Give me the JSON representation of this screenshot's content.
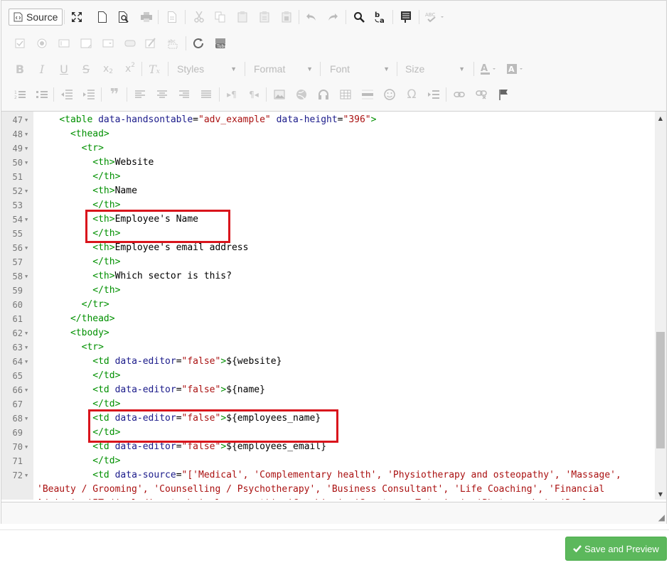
{
  "toolbar": {
    "source_label": "Source",
    "styles_label": "Styles",
    "format_label": "Format",
    "font_label": "Font",
    "size_label": "Size"
  },
  "code": {
    "lines": [
      {
        "n": "47",
        "fold": true,
        "html": "    <span class=\"tag\">&lt;table</span> <span class=\"attr\">data-handsontable</span>=<span class=\"str\">\"adv_example\"</span> <span class=\"attr\">data-height</span>=<span class=\"str\">\"396\"</span><span class=\"tag\">&gt;</span>"
      },
      {
        "n": "48",
        "fold": true,
        "html": "      <span class=\"tag\">&lt;thead&gt;</span>"
      },
      {
        "n": "49",
        "fold": true,
        "html": "        <span class=\"tag\">&lt;tr&gt;</span>"
      },
      {
        "n": "50",
        "fold": true,
        "html": "          <span class=\"tag\">&lt;th&gt;</span>Website"
      },
      {
        "n": "51",
        "fold": false,
        "html": "          <span class=\"tag\">&lt;/th&gt;</span>"
      },
      {
        "n": "52",
        "fold": true,
        "html": "          <span class=\"tag\">&lt;th&gt;</span>Name"
      },
      {
        "n": "53",
        "fold": false,
        "html": "          <span class=\"tag\">&lt;/th&gt;</span>"
      },
      {
        "n": "54",
        "fold": true,
        "html": "          <span class=\"tag\">&lt;th&gt;</span>Employee's Name"
      },
      {
        "n": "55",
        "fold": false,
        "html": "          <span class=\"tag\">&lt;/th&gt;</span>"
      },
      {
        "n": "56",
        "fold": true,
        "html": "          <span class=\"tag\">&lt;th&gt;</span>Employee's email address"
      },
      {
        "n": "57",
        "fold": false,
        "html": "          <span class=\"tag\">&lt;/th&gt;</span>"
      },
      {
        "n": "58",
        "fold": true,
        "html": "          <span class=\"tag\">&lt;th&gt;</span>Which sector is this?"
      },
      {
        "n": "59",
        "fold": false,
        "html": "          <span class=\"tag\">&lt;/th&gt;</span>"
      },
      {
        "n": "60",
        "fold": false,
        "html": "        <span class=\"tag\">&lt;/tr&gt;</span>"
      },
      {
        "n": "61",
        "fold": false,
        "html": "      <span class=\"tag\">&lt;/thead&gt;</span>"
      },
      {
        "n": "62",
        "fold": true,
        "html": "      <span class=\"tag\">&lt;tbody&gt;</span>"
      },
      {
        "n": "63",
        "fold": true,
        "html": "        <span class=\"tag\">&lt;tr&gt;</span>"
      },
      {
        "n": "64",
        "fold": true,
        "html": "          <span class=\"tag\">&lt;td</span> <span class=\"attr\">data-editor</span>=<span class=\"str\">\"false\"</span><span class=\"tag\">&gt;</span>${website}"
      },
      {
        "n": "65",
        "fold": false,
        "html": "          <span class=\"tag\">&lt;/td&gt;</span>"
      },
      {
        "n": "66",
        "fold": true,
        "html": "          <span class=\"tag\">&lt;td</span> <span class=\"attr\">data-editor</span>=<span class=\"str\">\"false\"</span><span class=\"tag\">&gt;</span>${name}"
      },
      {
        "n": "67",
        "fold": false,
        "html": "          <span class=\"tag\">&lt;/td&gt;</span>"
      },
      {
        "n": "68",
        "fold": true,
        "html": "          <span class=\"tag\">&lt;td</span> <span class=\"attr\">data-editor</span>=<span class=\"str\">\"false\"</span><span class=\"tag\">&gt;</span>${employees_name}"
      },
      {
        "n": "69",
        "fold": false,
        "html": "          <span class=\"tag\">&lt;/td&gt;</span>"
      },
      {
        "n": "70",
        "fold": true,
        "html": "          <span class=\"tag\">&lt;td</span> <span class=\"attr\">data-editor</span>=<span class=\"str\">\"false\"</span><span class=\"tag\">&gt;</span>${employees_email}"
      },
      {
        "n": "71",
        "fold": false,
        "html": "          <span class=\"tag\">&lt;/td&gt;</span>"
      },
      {
        "n": "72",
        "fold": true,
        "html": "          <span class=\"tag\">&lt;td</span> <span class=\"attr\">data-source</span>=<span class=\"str\">\"['Medical', 'Complementary health', 'Physiotherapy and osteopathy', 'Massage',</span>"
      },
      {
        "n": "",
        "fold": false,
        "html": "<span class=\"str\">'Beauty / Grooming', 'Counselling / Psychotherapy', 'Business Consultant', 'Life Coaching', 'Financial</span>"
      },
      {
        "n": "",
        "fold": false,
        "html": "<span class=\"str\">Advice', 'IT (including technical support)', 'Coaching', 'Sports or Tutoring', 'Photography', 'Doula</span>"
      }
    ]
  },
  "footer": {
    "save_label": "Save and Preview"
  },
  "colors": {
    "tag": "#009000",
    "attribute": "#1a1a8a",
    "string": "#aa1111",
    "highlight_box": "#d9141c",
    "save_button": "#5cb85c"
  }
}
